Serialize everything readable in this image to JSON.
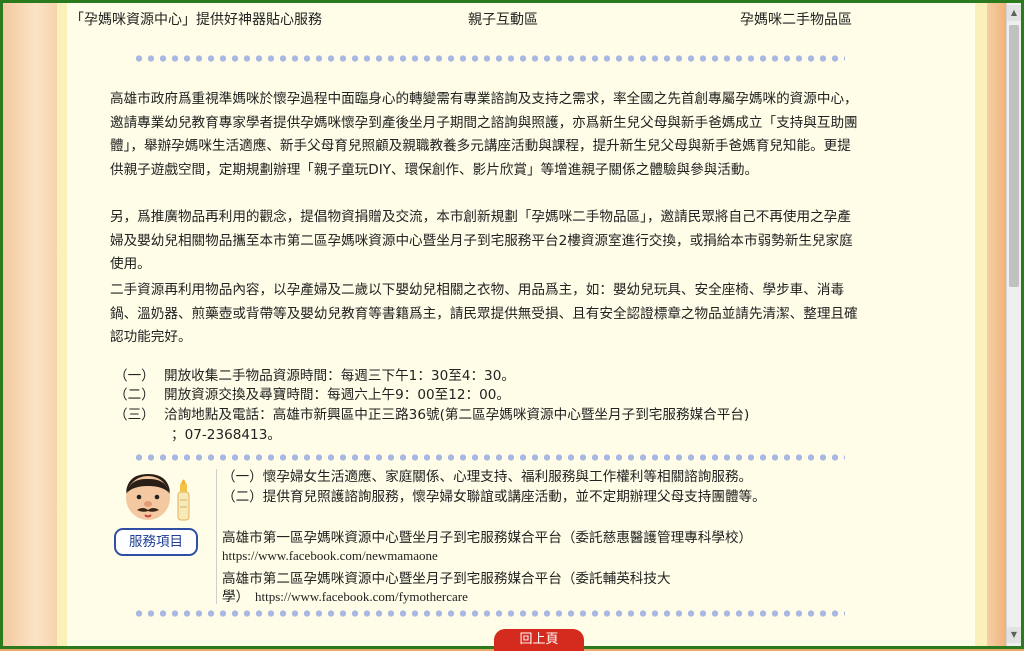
{
  "nav": {
    "link1": "「孕媽咪資源中心」提供好神器貼心服務",
    "link2": "親子互動區",
    "link3": "孕媽咪二手物品區"
  },
  "intro": {
    "p1": "高雄市政府爲重視準媽咪於懷孕過程中面臨身心的轉變需有專業諮詢及支持之需求，率全國之先首創專屬孕媽咪的資源中心，邀請專業幼兒教育專家學者提供孕媽咪懷孕到產後坐月子期間之諮詢與照護，亦爲新生兒父母與新手爸媽成立「支持與互助團體」，舉辦孕媽咪生活適應、新手父母育兒照顧及親職教養多元講座活動與課程，提升新生兒父母與新手爸媽育兒知能。更提供親子遊戲空間，定期規劃辦理「親子童玩DIY、環保創作、影片欣賞」等增進親子關係之體驗與參與活動。",
    "p2": "另，爲推廣物品再利用的觀念，提倡物資捐贈及交流，本市創新規劃「孕媽咪二手物品區」，邀請民眾將自己不再使用之孕產婦及嬰幼兒相關物品攜至本市第二區孕媽咪資源中心暨坐月子到宅服務平台2樓資源室進行交換，或捐給本市弱勢新生兒家庭使用。",
    "p3": "二手資源再利用物品內容，以孕產婦及二歲以下嬰幼兒相關之衣物、用品爲主，如：嬰幼兒玩具、安全座椅、學步車、消毒鍋、溫奶器、煎藥壺或背帶等及嬰幼兒教育等書籍爲主，請民眾提供無受損、且有安全認證標章之物品並請先清潔、整理且確認功能完好。"
  },
  "list": [
    {
      "num": "（一）",
      "text": "開放收集二手物品資源時間：每週三下午1：30至4：30。"
    },
    {
      "num": "（二）",
      "text": "開放資源交換及尋寶時間：每週六上午9：00至12：00。"
    },
    {
      "num": "（三）",
      "text": "洽詢地點及電話：高雄市新興區中正三路36號(第二區孕媽咪資源中心暨坐月子到宅服務媒合平台)",
      "cont": "；07-2368413。"
    }
  ],
  "services": {
    "button_label": "服務項目",
    "item1": "（一）懷孕婦女生活適應、家庭關係、心理支持、福利服務與工作權利等相關諮詢服務。",
    "item2": "（二）提供育兒照護諮詢服務，懷孕婦女聯誼或講座活動，並不定期辦理父母支持團體等。",
    "center1_name": "高雄市第一區孕媽咪資源中心暨坐月子到宅服務媒合平台（委託慈惠醫護管理專科學校）",
    "center1_url": "https://www.facebook.com/newmamaone",
    "center2_name_line1": "高雄市第二區孕媽咪資源中心暨坐月子到宅服務媒合平台（委託輔英科技大",
    "center2_name_line2": "學）",
    "center2_url": "https://www.facebook.com/fymothercare"
  },
  "back_to_top": "回上頁",
  "colors": {
    "frame": "#2c7a1e",
    "page_bg": "#fffde8",
    "dots": "#a9b8e2",
    "service_button": "#2f4fa5",
    "top_button": "#d42b1e"
  }
}
